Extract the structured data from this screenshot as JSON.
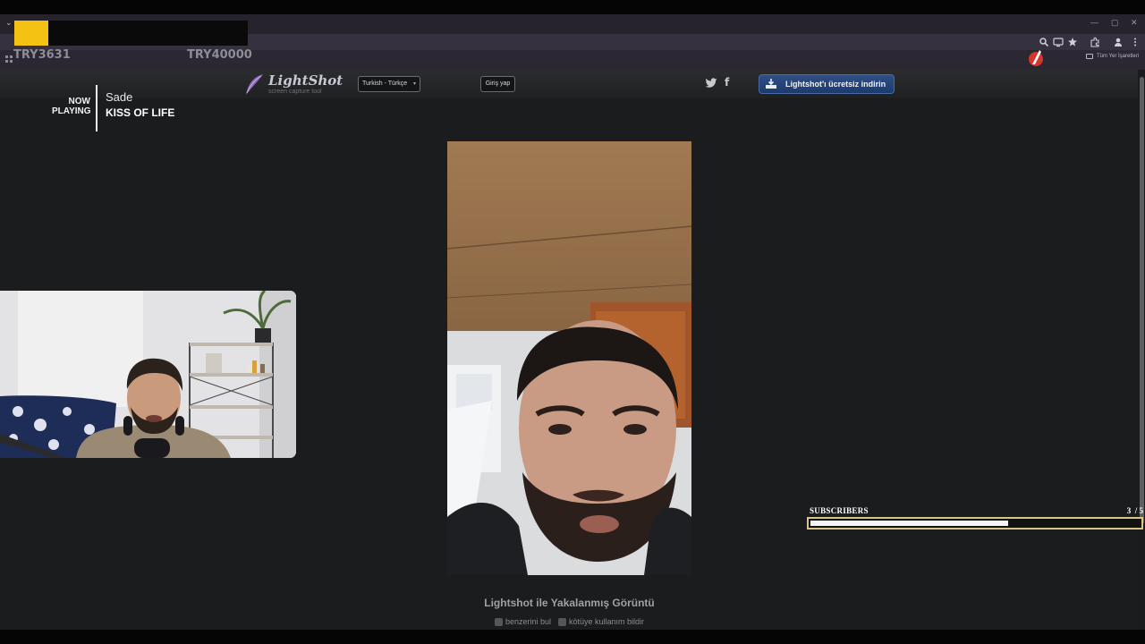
{
  "browser": {
    "tabstrip_menu": "⌄",
    "window_controls": [
      "—",
      "▢",
      "✕"
    ],
    "bookmark_folder_label": "Tüm Yer İşaretleri"
  },
  "stream_overlay": {
    "currency_left": "TRY3631",
    "currency_right": "TRY40000",
    "now_playing_label": "NOW PLAYING",
    "artist": "Sade",
    "song": "KISS OF LIFE",
    "subscribers_label": "SUBSCRIBERS",
    "subscribers_count": "3  / 5",
    "subscribers_progress": 0.6
  },
  "site": {
    "logo_text": "LightShot",
    "logo_subtitle": "screen capture tool",
    "language": "Turkish - Türkçe",
    "login_label": "Giriş yap",
    "facebook_glyph": "f",
    "download_label": "Lightshot'ı ücretsiz indirin",
    "caption": "Lightshot ile Yakalanmış Görüntü",
    "similar_label": "benzerini bul",
    "report_label": "kötüye kullanım bildir"
  },
  "colors": {
    "accent_blue": "#2f4f86",
    "progress_border": "#d9c48a",
    "redaction_yellow": "#f3c213"
  }
}
